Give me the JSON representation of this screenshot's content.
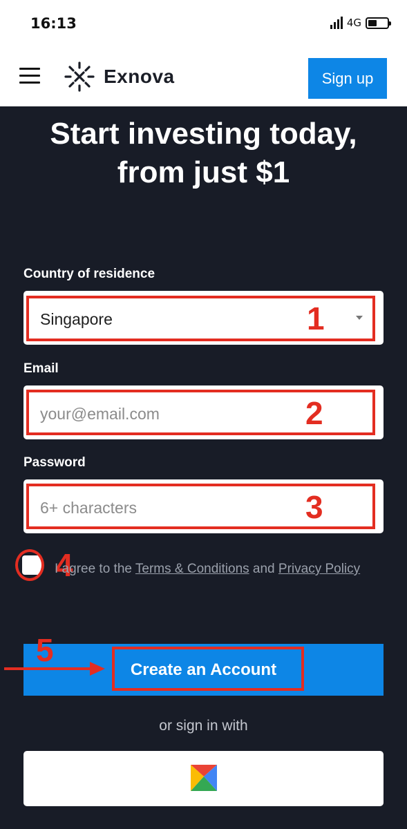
{
  "status_bar": {
    "time": "16:13",
    "network": "4G"
  },
  "header": {
    "brand": "Exnova",
    "signup_label": "Sign up",
    "menu_icon": "hamburger-icon",
    "logo_icon": "exnova-logo-icon"
  },
  "hero": {
    "title_line1": "Start investing today,",
    "title_line2": "from just $1"
  },
  "form": {
    "country_label": "Country of residence",
    "country_value": "Singapore",
    "email_label": "Email",
    "email_placeholder": "your@email.com",
    "password_label": "Password",
    "password_placeholder": "6+ characters",
    "agree_prefix": "I agree to the",
    "terms_link": "Terms & Conditions",
    "agree_and": "and",
    "privacy_link": "Privacy Policy",
    "create_label": "Create an Account",
    "or_signin": "or sign in with",
    "google_icon": "gmail-icon"
  },
  "annotations": {
    "step1": "1",
    "step2": "2",
    "step3": "3",
    "step4": "4",
    "step5": "5"
  },
  "colors": {
    "background": "#181c27",
    "accent_blue": "#0d86e6",
    "annotation_red": "#e32d21"
  }
}
